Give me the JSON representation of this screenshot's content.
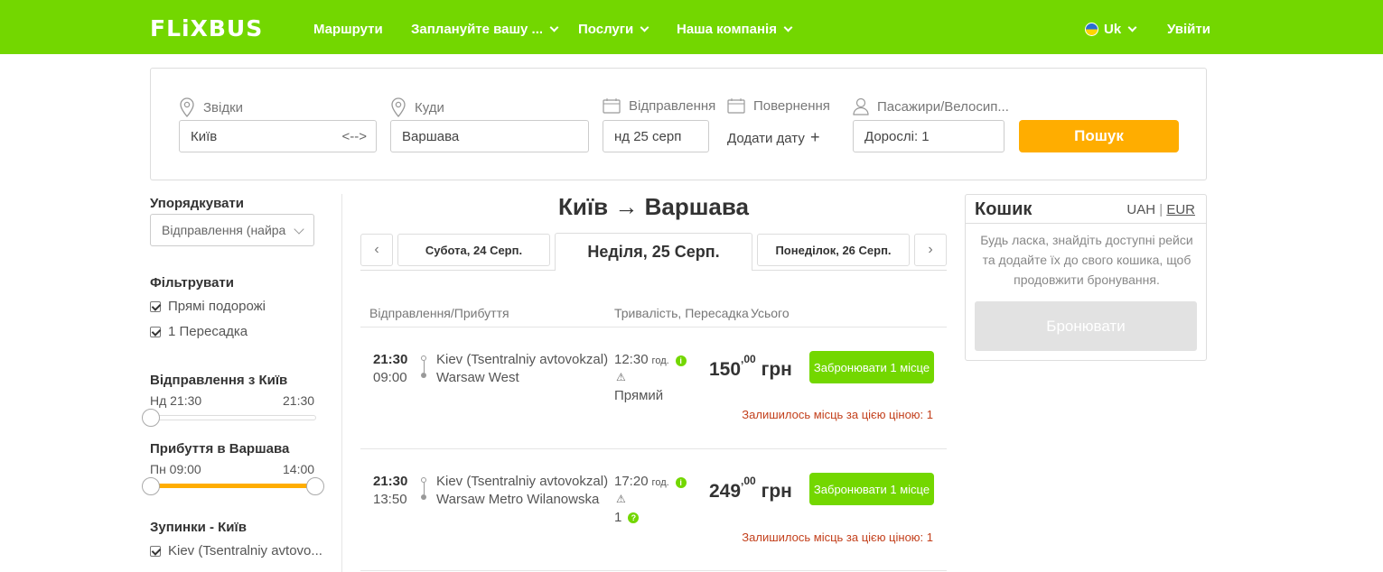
{
  "header": {
    "logo": "FLiXBUS",
    "nav": [
      {
        "label": "Маршрути"
      },
      {
        "label": "Заплануйте вашу ..."
      },
      {
        "label": "Послуги"
      },
      {
        "label": "Наша компанія"
      }
    ],
    "language": "Uk",
    "login": "Увійти"
  },
  "search": {
    "from_label": "Звідки",
    "from_value": "Київ",
    "to_label": "Куди",
    "to_value": "Варшава",
    "departure_label": "Відправлення",
    "departure_value": "нд 25 серп",
    "return_label": "Повернення",
    "return_add": "Додати дату",
    "passengers_label": "Пасажири/Велосип...",
    "passengers_value": "Дорослі: 1",
    "search_button": "Пошук"
  },
  "sidebar": {
    "sort_title": "Упорядкувати",
    "sort_value": "Відправлення (найра",
    "filter_title": "Фільтрувати",
    "filters": [
      "Прямі подорожі",
      "1 Пересадка"
    ],
    "departure_title": "Відправлення з Київ",
    "departure_from": "Нд 21:30",
    "departure_to": "21:30",
    "arrival_title": "Прибуття в Варшава",
    "arrival_from": "Пн 09:00",
    "arrival_to": "14:00",
    "stops_title": "Зупинки - Київ",
    "stops": [
      "Kiev (Tsentralniy avtovo..."
    ]
  },
  "results": {
    "route_title": "Київ → Варшава",
    "prev_arrow": "‹",
    "next_arrow": "›",
    "date_tabs": [
      "Субота, 24 Серп.",
      "Неділя, 25 Серп.",
      "Понеділок, 26 Серп."
    ],
    "columns": [
      "Відправлення/Прибуття",
      "Тривалість, Пересадка",
      "Усього"
    ],
    "trips": [
      {
        "dep_time": "21:30",
        "arr_time": "09:00",
        "from": "Kiev (Tsentralniy avtovokzal)",
        "to": "Warsaw West",
        "duration": "12:30",
        "duration_unit": "год.",
        "transfer": "Прямий",
        "price_main": "150",
        "price_cents": ",00",
        "price_currency": "грн",
        "book_label": "Забронювати 1 місце",
        "seats_note": "Залишилось місць за цією ціною: 1"
      },
      {
        "dep_time": "21:30",
        "arr_time": "13:50",
        "from": "Kiev (Tsentralniy avtovokzal)",
        "to": "Warsaw Metro Wilanowska",
        "duration": "17:20",
        "duration_unit": "год.",
        "transfer": "1",
        "price_main": "249",
        "price_cents": ",00",
        "price_currency": "грн",
        "book_label": "Забронювати 1 місце",
        "seats_note": "Залишилось місць за цією ціною: 1"
      }
    ]
  },
  "cart": {
    "title": "Кошик",
    "currency_uah": "UAH",
    "currency_sep": "|",
    "currency_eur": "EUR",
    "text": "Будь ласка, знайдіть доступні рейси та додайте їх до свого кошика, щоб продовжити бронування.",
    "button": "Бронювати"
  },
  "colors": {
    "brand_green": "#73d700",
    "accent_orange": "#ffad00",
    "warning_red": "#c3401c"
  }
}
